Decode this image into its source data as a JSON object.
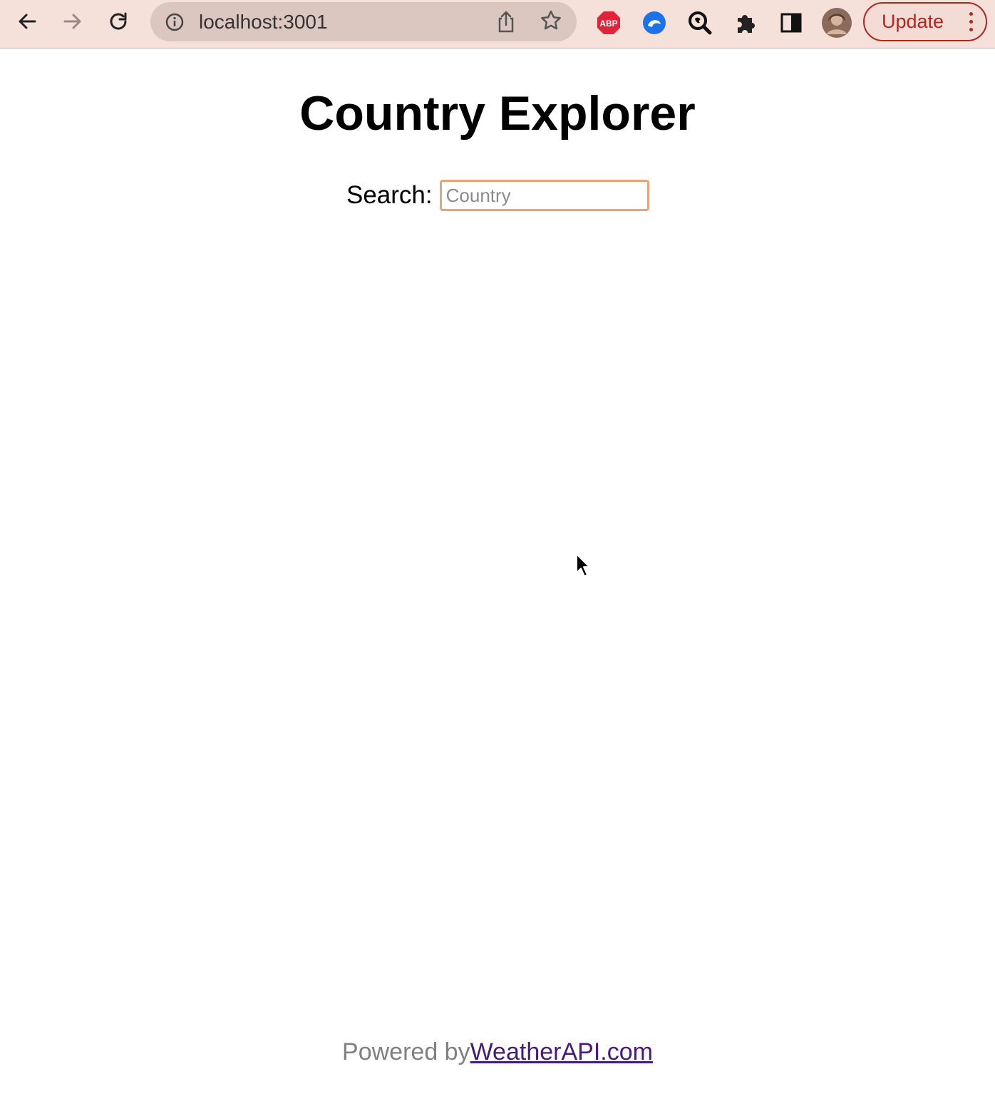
{
  "browser": {
    "url": "localhost:3001",
    "update_label": "Update",
    "extensions": [
      "abp-icon",
      "edge-icon",
      "search-extension-icon",
      "puzzle-icon",
      "sidepanel-icon",
      "avatar"
    ],
    "abp_text": "ABP"
  },
  "page": {
    "title": "Country Explorer",
    "search": {
      "label": "Search:",
      "placeholder": "Country",
      "value": ""
    },
    "footer": {
      "powered_by": "Powered by",
      "link_text": "WeatherAPI.com"
    }
  },
  "colors": {
    "toolbar_bg": "#f5e1da",
    "update_accent": "#b3261e",
    "input_border": "#e8a37a",
    "link": "#4a1a7a"
  }
}
